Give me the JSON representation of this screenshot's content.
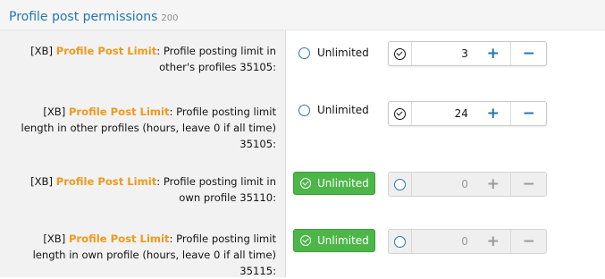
{
  "header": {
    "title": "Profile post permissions",
    "count": "200"
  },
  "rows": [
    {
      "prefix": "[XB] ",
      "addon": "Profile Post Limit",
      "text": ": Profile posting limit in other's profiles 35105:",
      "unlimited_label": "Unlimited",
      "unlimited_selected": false,
      "value": "3",
      "plus": "+",
      "minus": "−"
    },
    {
      "prefix": "[XB] ",
      "addon": "Profile Post Limit",
      "text": ": Profile posting limit length in other profiles (hours, leave 0 if all time) 35105:",
      "unlimited_label": "Unlimited",
      "unlimited_selected": false,
      "value": "24",
      "plus": "+",
      "minus": "−"
    },
    {
      "prefix": "[XB] ",
      "addon": "Profile Post Limit",
      "text": ": Profile posting limit in own profile 35110:",
      "unlimited_label": "Unlimited",
      "unlimited_selected": true,
      "value": "0",
      "plus": "+",
      "minus": "−"
    },
    {
      "prefix": "[XB] ",
      "addon": "Profile Post Limit",
      "text": ": Profile posting limit length in own profile (hours, leave 0 if all time) 35115:",
      "unlimited_label": "Unlimited",
      "unlimited_selected": true,
      "value": "0",
      "plus": "+",
      "minus": "−"
    }
  ],
  "colors": {
    "title": "#2577b1",
    "addon": "#ec9a1e",
    "unlimited_active": "#4cb748"
  }
}
